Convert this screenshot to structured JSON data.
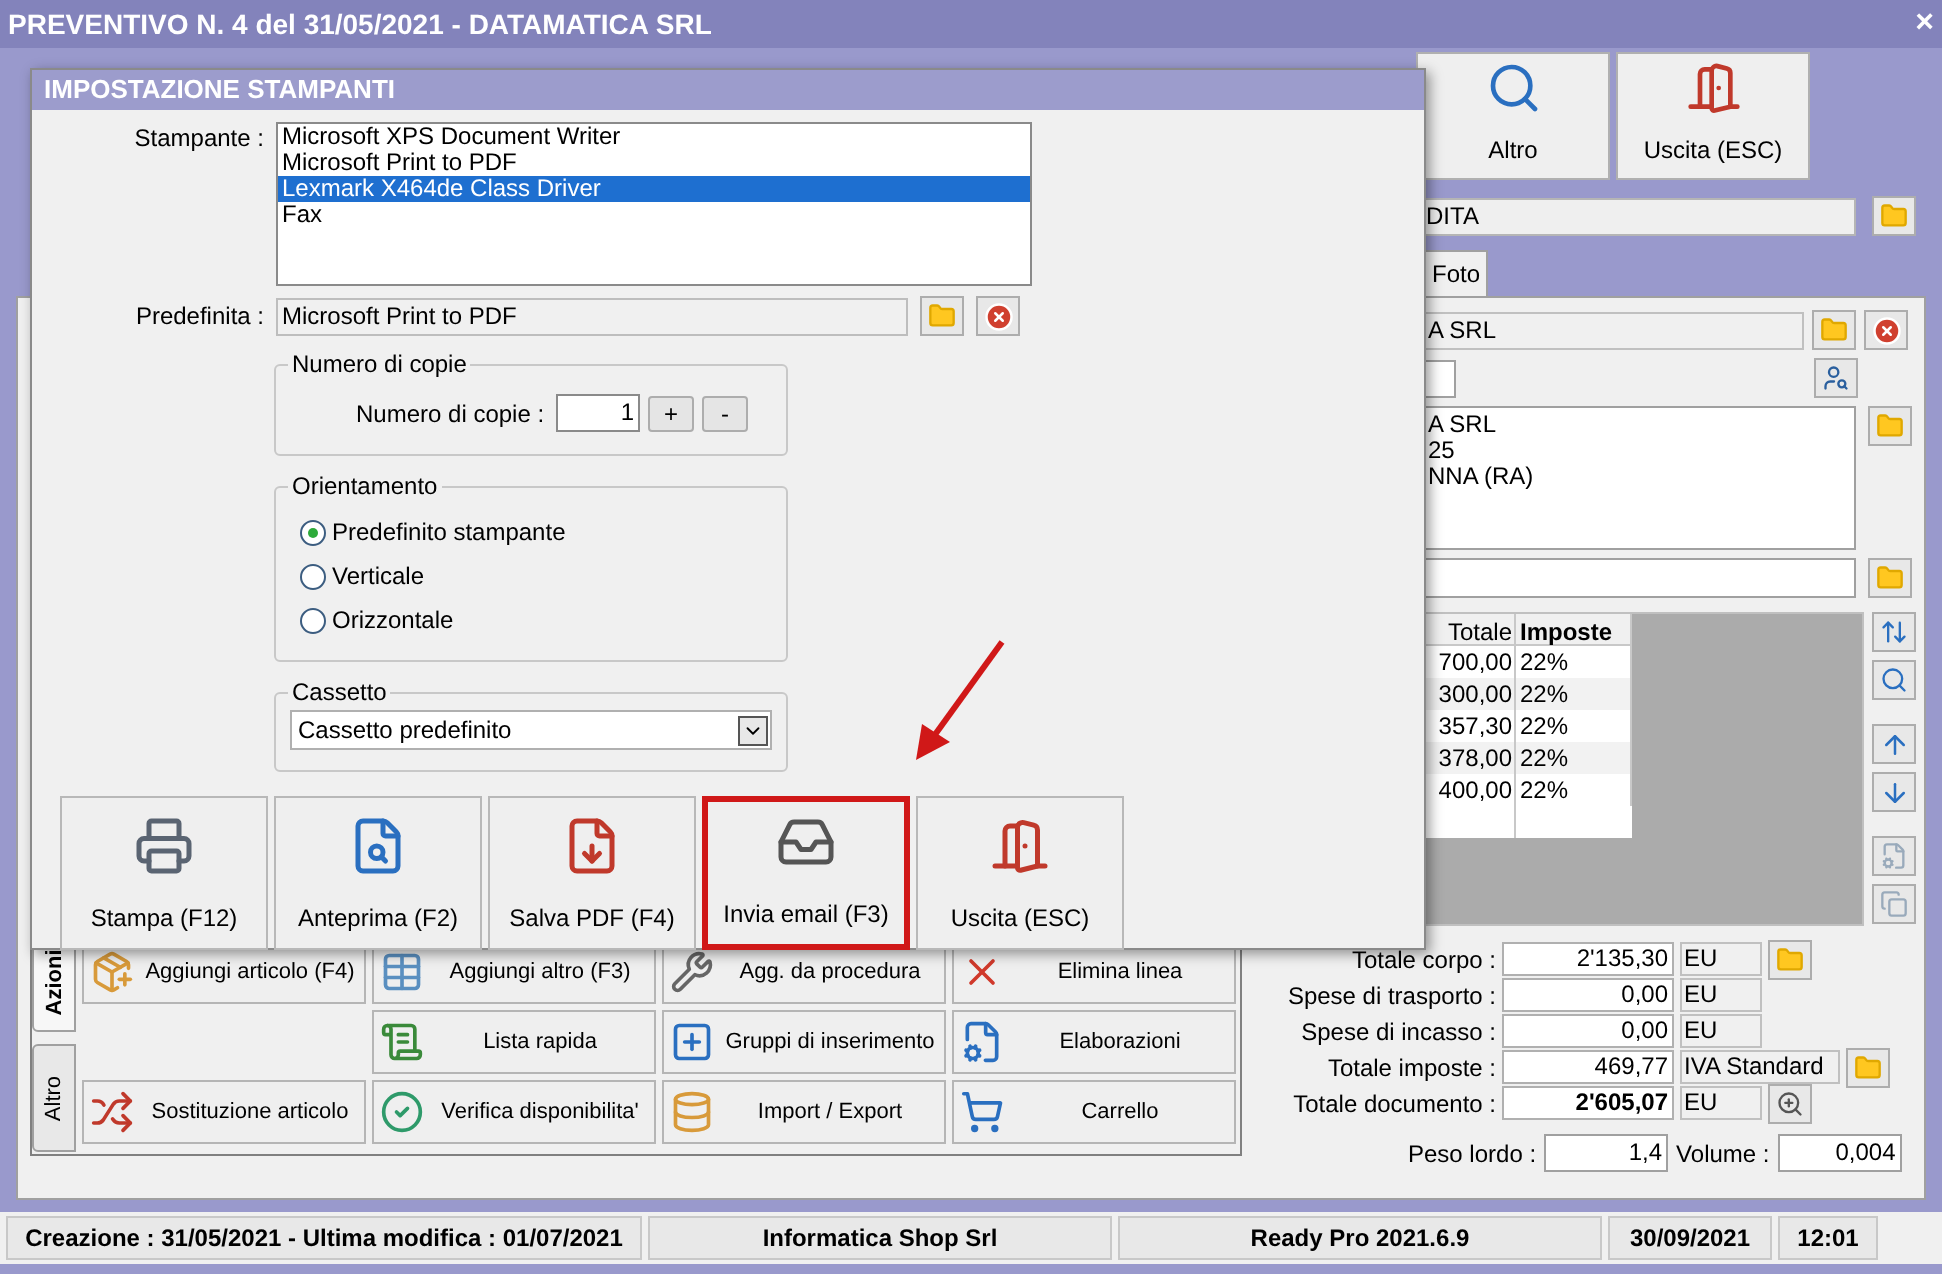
{
  "window": {
    "title": "PREVENTIVO N. 4 del 31/05/2021 - DATAMATICA SRL",
    "close": "×"
  },
  "toolbar": [
    {
      "label": "Altro"
    },
    {
      "label": "Uscita (ESC)"
    }
  ],
  "header_field": {
    "value": "DITA"
  },
  "tabs": [
    {
      "label": "Foto",
      "selected": false
    }
  ],
  "customer": {
    "name": "A SRL",
    "address_lines": [
      "A SRL",
      "25",
      "NNA (RA)"
    ]
  },
  "lines_table": {
    "columns": [
      "Totale",
      "Imposte"
    ],
    "rows": [
      [
        "700,00",
        "22%"
      ],
      [
        "300,00",
        "22%"
      ],
      [
        "357,30",
        "22%"
      ],
      [
        "378,00",
        "22%"
      ],
      [
        "400,00",
        "22%"
      ]
    ]
  },
  "totals": [
    {
      "label": "Totale corpo :",
      "value": "2'135,30",
      "unit": "EU",
      "emphasis": false
    },
    {
      "label": "Spese di trasporto :",
      "value": "0,00",
      "unit": "EU",
      "emphasis": false
    },
    {
      "label": "Spese di incasso :",
      "value": "0,00",
      "unit": "EU",
      "emphasis": false
    },
    {
      "label": "Totale imposte :",
      "value": "469,77",
      "unit": "IVA Standard",
      "emphasis": false
    },
    {
      "label": "Totale documento :",
      "value": "2'605,07",
      "unit": "EU",
      "emphasis": true
    }
  ],
  "measures": [
    {
      "label": "Peso lordo :",
      "value": "1,4"
    },
    {
      "label": "Volume :",
      "value": "0,004"
    }
  ],
  "actions": {
    "tabs": [
      {
        "label": "Azioni",
        "selected": true
      },
      {
        "label": "Altro",
        "selected": false
      }
    ],
    "rows": [
      [
        "Aggiungi articolo (F4)",
        "Aggiungi altro (F3)",
        "Agg. da procedura",
        "Elimina linea"
      ],
      [
        "",
        "Lista rapida",
        "Gruppi di inserimento",
        "Elaborazioni"
      ],
      [
        "Sostituzione articolo",
        "Verifica disponibilita'",
        "Import / Export",
        "Carrello"
      ]
    ]
  },
  "dialog": {
    "title": "IMPOSTAZIONE STAMPANTI",
    "printer_label": "Stampante :",
    "printers": [
      {
        "label": "Microsoft XPS Document Writer",
        "selected": false
      },
      {
        "label": "Microsoft Print to PDF",
        "selected": false
      },
      {
        "label": "Lexmark X464de Class Driver",
        "selected": true
      },
      {
        "label": "Fax",
        "selected": false
      }
    ],
    "default_label": "Predefinita :",
    "default_value": "Microsoft Print to PDF",
    "copies": {
      "group": "Numero di copie",
      "label": "Numero di copie :",
      "value": "1",
      "plus": "+",
      "minus": "-"
    },
    "orientation": {
      "group": "Orientamento",
      "options": [
        {
          "label": "Predefinito stampante",
          "selected": true
        },
        {
          "label": "Verticale",
          "selected": false
        },
        {
          "label": "Orizzontale",
          "selected": false
        }
      ]
    },
    "tray": {
      "group": "Cassetto",
      "value": "Cassetto predefinito"
    },
    "buttons": [
      {
        "label": "Stampa (F12)",
        "highlighted": false
      },
      {
        "label": "Anteprima (F2)",
        "highlighted": false
      },
      {
        "label": "Salva PDF (F4)",
        "highlighted": false
      },
      {
        "label": "Invia email (F3)",
        "highlighted": true
      },
      {
        "label": "Uscita (ESC)",
        "highlighted": false
      }
    ]
  },
  "status_bar": [
    "Creazione : 31/05/2021 - Ultima modifica : 01/07/2021",
    "Informatica Shop Srl",
    "Ready Pro 2021.6.9",
    "30/09/2021",
    "12:01"
  ]
}
